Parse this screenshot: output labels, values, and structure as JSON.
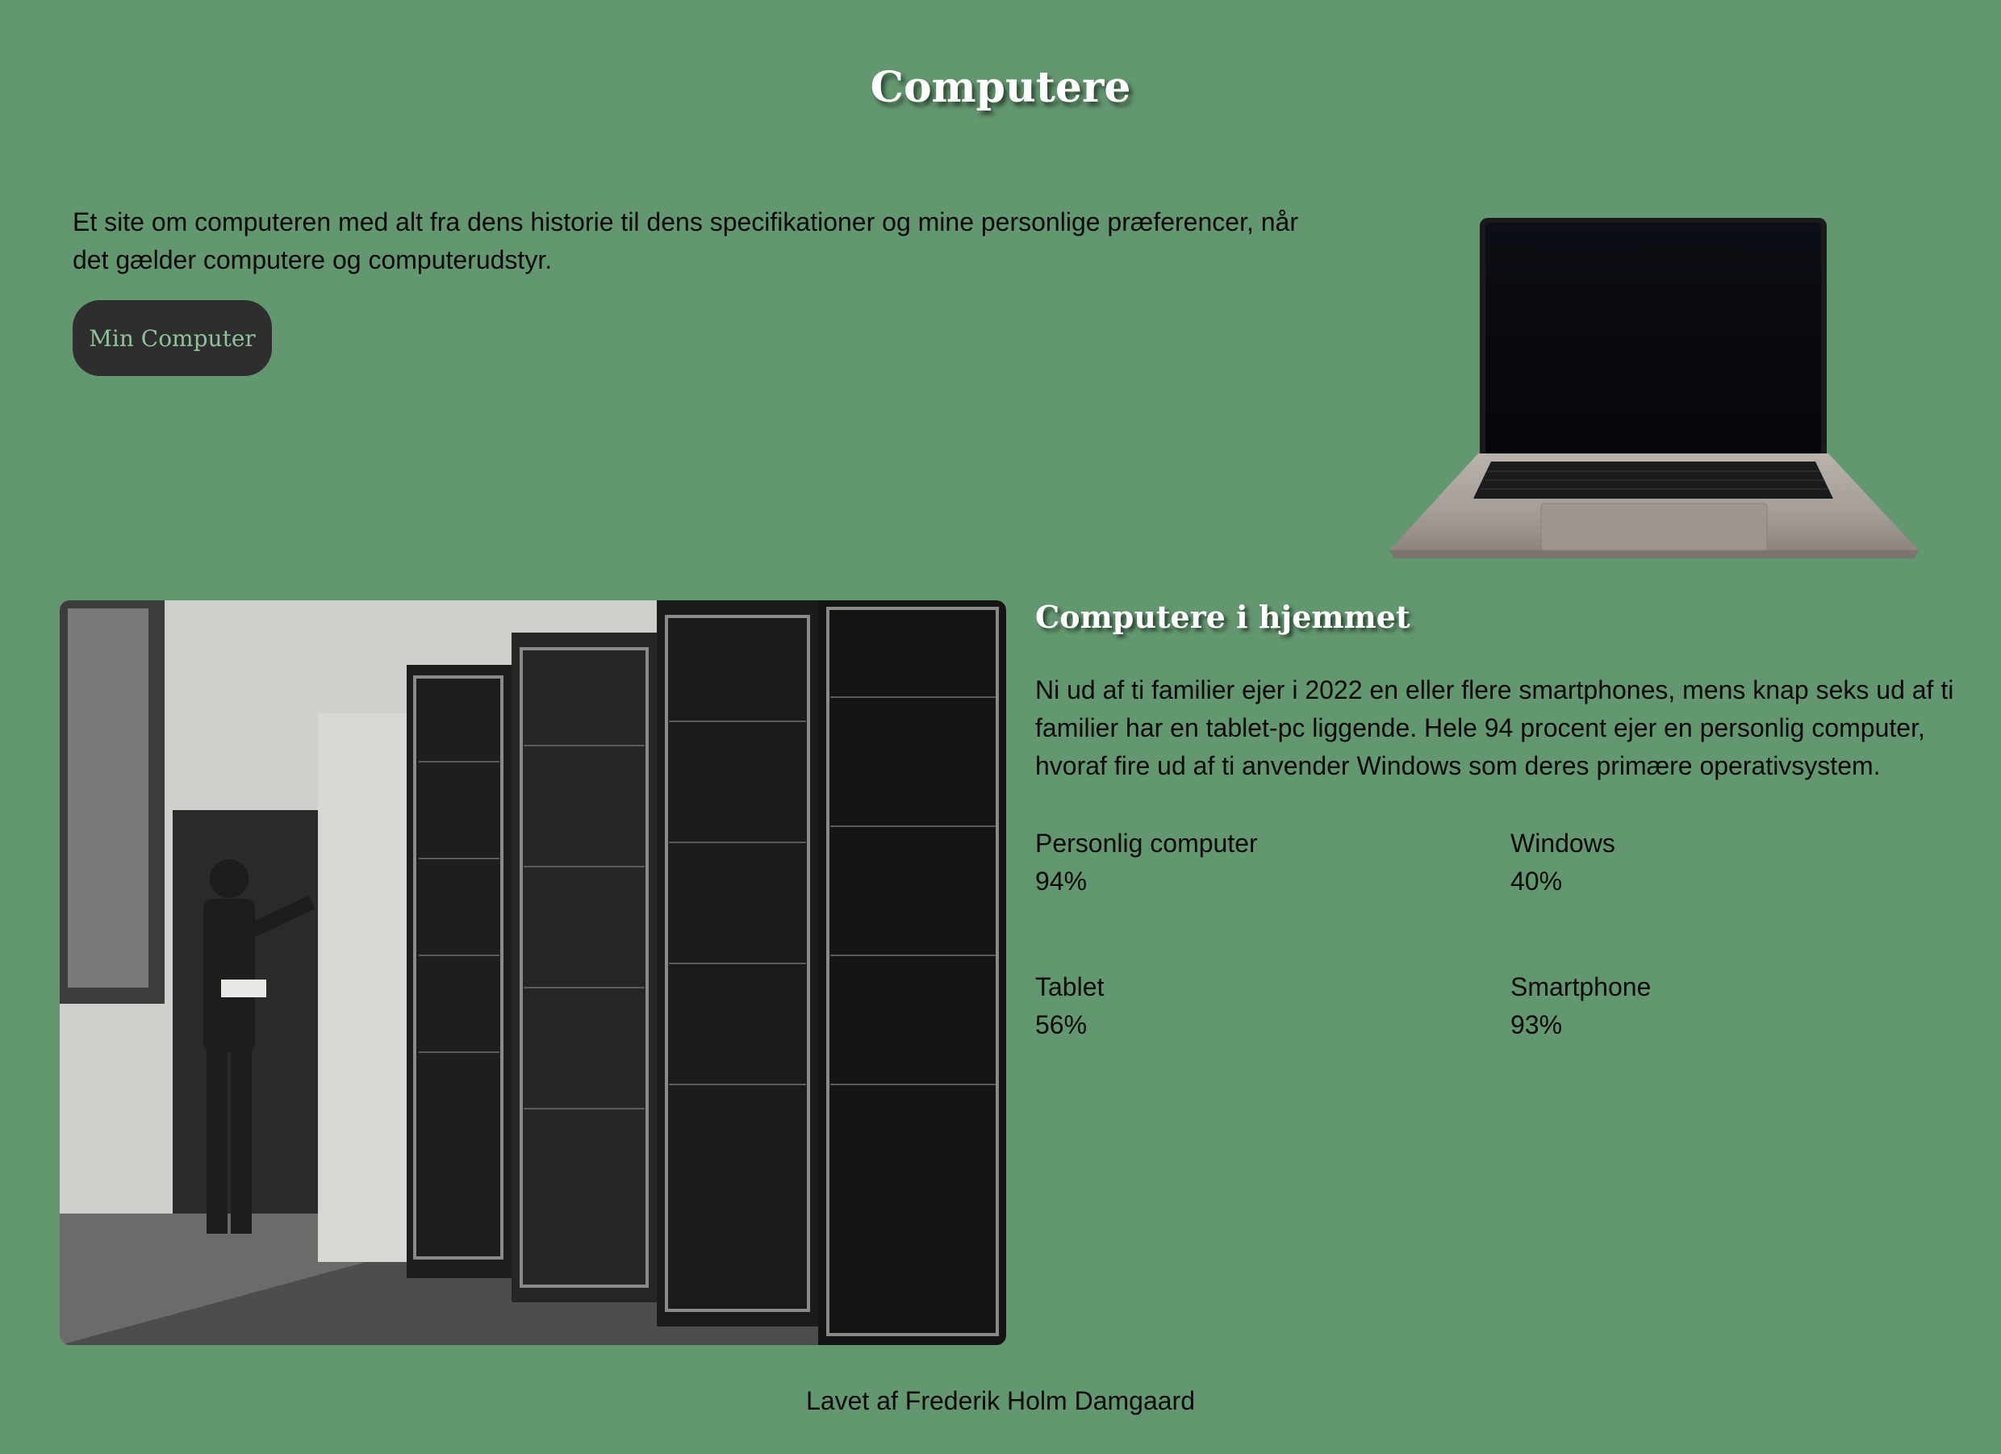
{
  "header": {
    "title": "Computere"
  },
  "intro": {
    "text": "Et site om computeren med alt fra dens historie til dens specifikationer og mine personlige præferencer, når det gælder computere og computerudstyr.",
    "button_label": "Min Computer"
  },
  "section": {
    "heading": "Computere i hjemmet",
    "text": "Ni ud af ti familier ejer i 2022 en eller flere smartphones, mens knap seks ud af ti familier har en tablet-pc liggende. Hele 94 procent ejer en personlig computer, hvoraf fire ud af ti anvender Windows som deres primære operativsystem.",
    "stats": [
      {
        "label": "Personlig computer",
        "value": "94%"
      },
      {
        "label": "Windows",
        "value": "40%"
      },
      {
        "label": "Tablet",
        "value": "56%"
      },
      {
        "label": "Smartphone",
        "value": "93%"
      }
    ]
  },
  "images": {
    "hero": "laptop-image",
    "history": "vintage-computer-room-photo"
  },
  "footer": {
    "text": "Lavet af Frederik Holm Damgaard"
  },
  "colors": {
    "background": "#63976f",
    "button_bg": "#2e2e2e",
    "button_text": "#8fc29a",
    "heading": "#ffffff"
  }
}
